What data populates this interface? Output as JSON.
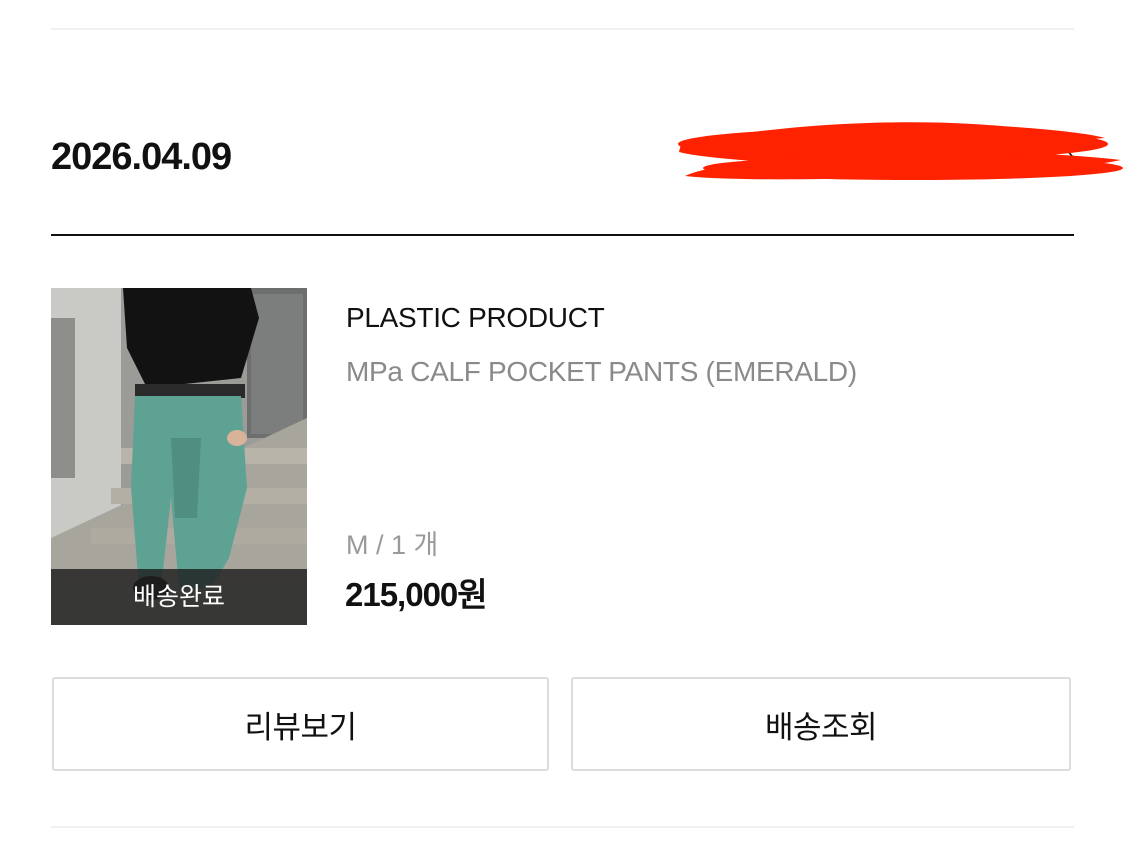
{
  "order": {
    "date": "2026.04.09",
    "detail_link_icon": "chevron-right-icon",
    "redaction_color": "#ff2200"
  },
  "item": {
    "status": "배송완료",
    "brand": "PLASTIC PRODUCT",
    "name": "MPa CALF POCKET PANTS (EMERALD)",
    "option": "M / 1 개",
    "price": "215,000원",
    "image_icon": "product-photo"
  },
  "actions": {
    "review_label": "리뷰보기",
    "track_label": "배송조회"
  }
}
